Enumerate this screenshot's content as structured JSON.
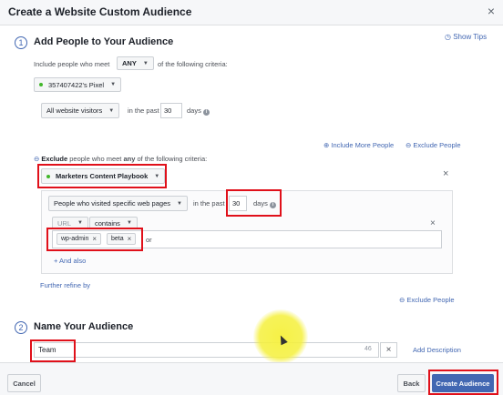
{
  "header": {
    "title": "Create a Website Custom Audience",
    "close": "×"
  },
  "step1": {
    "number": "1",
    "title": "Add People to Your Audience",
    "show_tips": "Show Tips",
    "include_prefix": "Include people who meet",
    "include_mode": "ANY",
    "include_suffix": "of the following criteria:",
    "pixel": "357407422's Pixel",
    "visitors": "All website visitors",
    "in_past": "in the past",
    "days_value": "30",
    "days": "days",
    "include_more": "Include More People",
    "exclude_people": "Exclude People"
  },
  "exclude": {
    "label_pre": "Exclude",
    "label_mid": "people who meet",
    "label_any": "any",
    "label_post": "of the following criteria:",
    "audience": "Marketers Content Playbook",
    "rule": "People who visited specific web pages",
    "in_past": "in the past",
    "days_value": "30",
    "days": "days",
    "url": "URL",
    "contains": "contains",
    "tags": [
      "wp-admin",
      "beta"
    ],
    "or": "or",
    "and_also": "+ And also",
    "further_refine": "Further refine by",
    "exclude_people": "Exclude People"
  },
  "step2": {
    "number": "2",
    "title": "Name Your Audience",
    "name_value": "Team",
    "char_count": "46",
    "add_description": "Add Description"
  },
  "footer": {
    "cancel": "Cancel",
    "back": "Back",
    "create": "Create Audience"
  }
}
